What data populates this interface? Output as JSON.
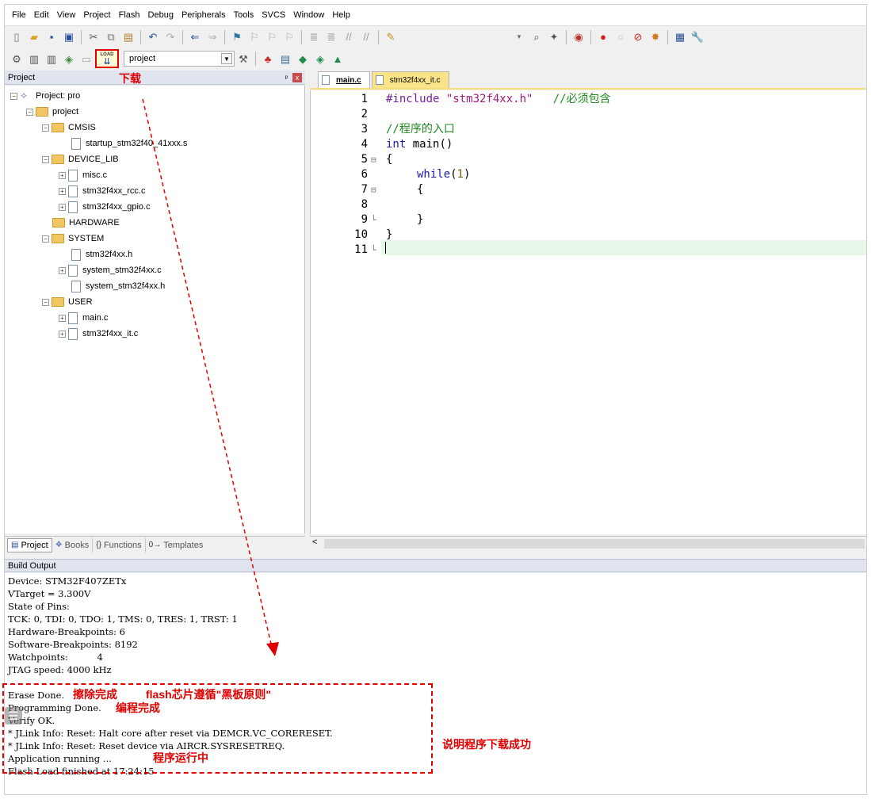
{
  "menu": [
    "File",
    "Edit",
    "View",
    "Project",
    "Flash",
    "Debug",
    "Peripherals",
    "Tools",
    "SVCS",
    "Window",
    "Help"
  ],
  "toolbar": {
    "target_value": "project",
    "load_text": "LOAD"
  },
  "project_pane": {
    "title": "Project",
    "pin": "ᵖ",
    "close": "x",
    "root": "Project: pro",
    "group": "project",
    "folders": [
      {
        "name": "CMSIS",
        "files": [
          "startup_stm32f40_41xxx.s"
        ]
      },
      {
        "name": "DEVICE_LIB",
        "files": [
          "misc.c",
          "stm32f4xx_rcc.c",
          "stm32f4xx_gpio.c"
        ]
      },
      {
        "name": "HARDWARE",
        "files": []
      },
      {
        "name": "SYSTEM",
        "files": [
          "stm32f4xx.h",
          "system_stm32f4xx.c",
          "system_stm32f4xx.h"
        ]
      },
      {
        "name": "USER",
        "files": [
          "main.c",
          "stm32f4xx_it.c"
        ]
      }
    ],
    "tabs": [
      "Project",
      "Books",
      "Functions",
      "Templates"
    ]
  },
  "editor": {
    "tabs": [
      "main.c",
      "stm32f4xx_it.c"
    ],
    "line_numbers": [
      "1",
      "2",
      "3",
      "4",
      "5",
      "6",
      "7",
      "8",
      "9",
      "10",
      "11"
    ],
    "code": {
      "l1_pp": "#include",
      "l1_str": "\"stm32f4xx.h\"",
      "l1_cm": "//必须包含",
      "l3_cm": "//程序的入口",
      "l4_kw": "int",
      "l4_rest": " main()",
      "l5": "{",
      "l6_kw": "while",
      "l6_open": "(",
      "l6_num": "1",
      "l6_close": ")",
      "l7": "{",
      "l9": "}",
      "l10": "}"
    },
    "scroll_left": "<"
  },
  "build_output": {
    "title": "Build Output",
    "lines": [
      "Device: STM32F407ZETx",
      "VTarget = 3.300V",
      "State of Pins:",
      "TCK: 0, TDI: 0, TDO: 1, TMS: 0, TRES: 1, TRST: 1",
      "Hardware-Breakpoints: 6",
      "Software-Breakpoints: 8192",
      "Watchpoints:          4",
      "JTAG speed: 4000 kHz",
      "",
      "Erase Done.",
      "Programming Done.",
      "Verify OK.",
      "* JLink Info: Reset: Halt core after reset via DEMCR.VC_CORERESET.",
      "* JLink Info: Reset: Reset device via AIRCR.SYSRESETREQ.",
      "Application running ...",
      "Flash Load finished at 17:24:15"
    ]
  },
  "annotations": {
    "download": "下载",
    "erase": "擦除完成",
    "flash_rule": "flash芯片遵循\"黑板原则\"",
    "programming": "编程完成",
    "running": "程序运行中",
    "success": "说明程序下载成功"
  },
  "colors": {
    "annotation": "#e00000",
    "tab_active_bar": "#f7dd7a",
    "current_line": "#e7f7e7"
  }
}
